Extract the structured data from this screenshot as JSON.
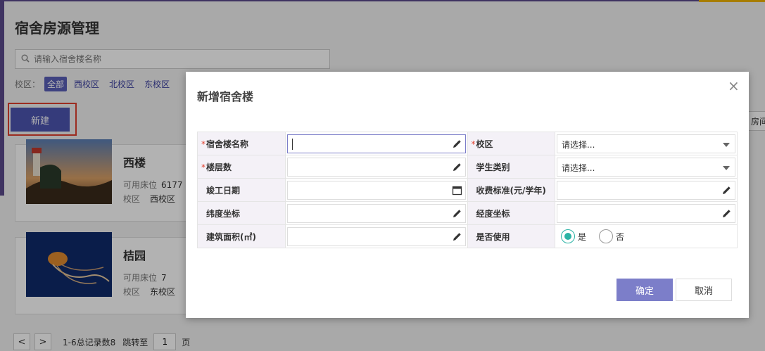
{
  "page": {
    "title": "宿舍房源管理",
    "search_placeholder": "请输入宿舍楼名称",
    "campus_label": "校区：",
    "campus_options": [
      "全部",
      "西校区",
      "北校区",
      "东校区"
    ],
    "new_button": "新建",
    "side_tab": "房间"
  },
  "cards": [
    {
      "name": "西楼",
      "beds_label": "可用床位",
      "beds": "6177",
      "campus_label": "校区",
      "campus": "西校区"
    },
    {
      "name": "桔园",
      "beds_label": "可用床位",
      "beds": "7",
      "campus_label": "校区",
      "campus": "东校区"
    }
  ],
  "pager": {
    "prev": "<",
    "next": ">",
    "summary": "1-6总记录数8",
    "jump_label": "跳转至",
    "page_value": "1",
    "page_unit": "页"
  },
  "modal": {
    "title": "新增宿舍楼",
    "close": "×",
    "fields": {
      "building_name": {
        "label": "宿舍楼名称",
        "value": ""
      },
      "campus": {
        "label": "校区",
        "value": "请选择..."
      },
      "floors": {
        "label": "楼层数",
        "value": ""
      },
      "student_type": {
        "label": "学生类别",
        "value": "请选择..."
      },
      "completion_date": {
        "label": "竣工日期",
        "value": ""
      },
      "fee_standard": {
        "label": "收费标准(元/学年)",
        "value": ""
      },
      "latitude": {
        "label": "纬度坐标",
        "value": ""
      },
      "longitude": {
        "label": "经度坐标",
        "value": ""
      },
      "area": {
        "label": "建筑面积(㎡)",
        "value": ""
      },
      "in_use": {
        "label": "是否使用",
        "yes": "是",
        "no": "否",
        "selected": "是"
      }
    },
    "confirm": "确定",
    "cancel": "取消"
  },
  "colors": {
    "primary": "#4d55b0",
    "confirm": "#7c7ec9",
    "radio_on": "#2bb3a5",
    "highlight_outline": "#e0402e"
  }
}
